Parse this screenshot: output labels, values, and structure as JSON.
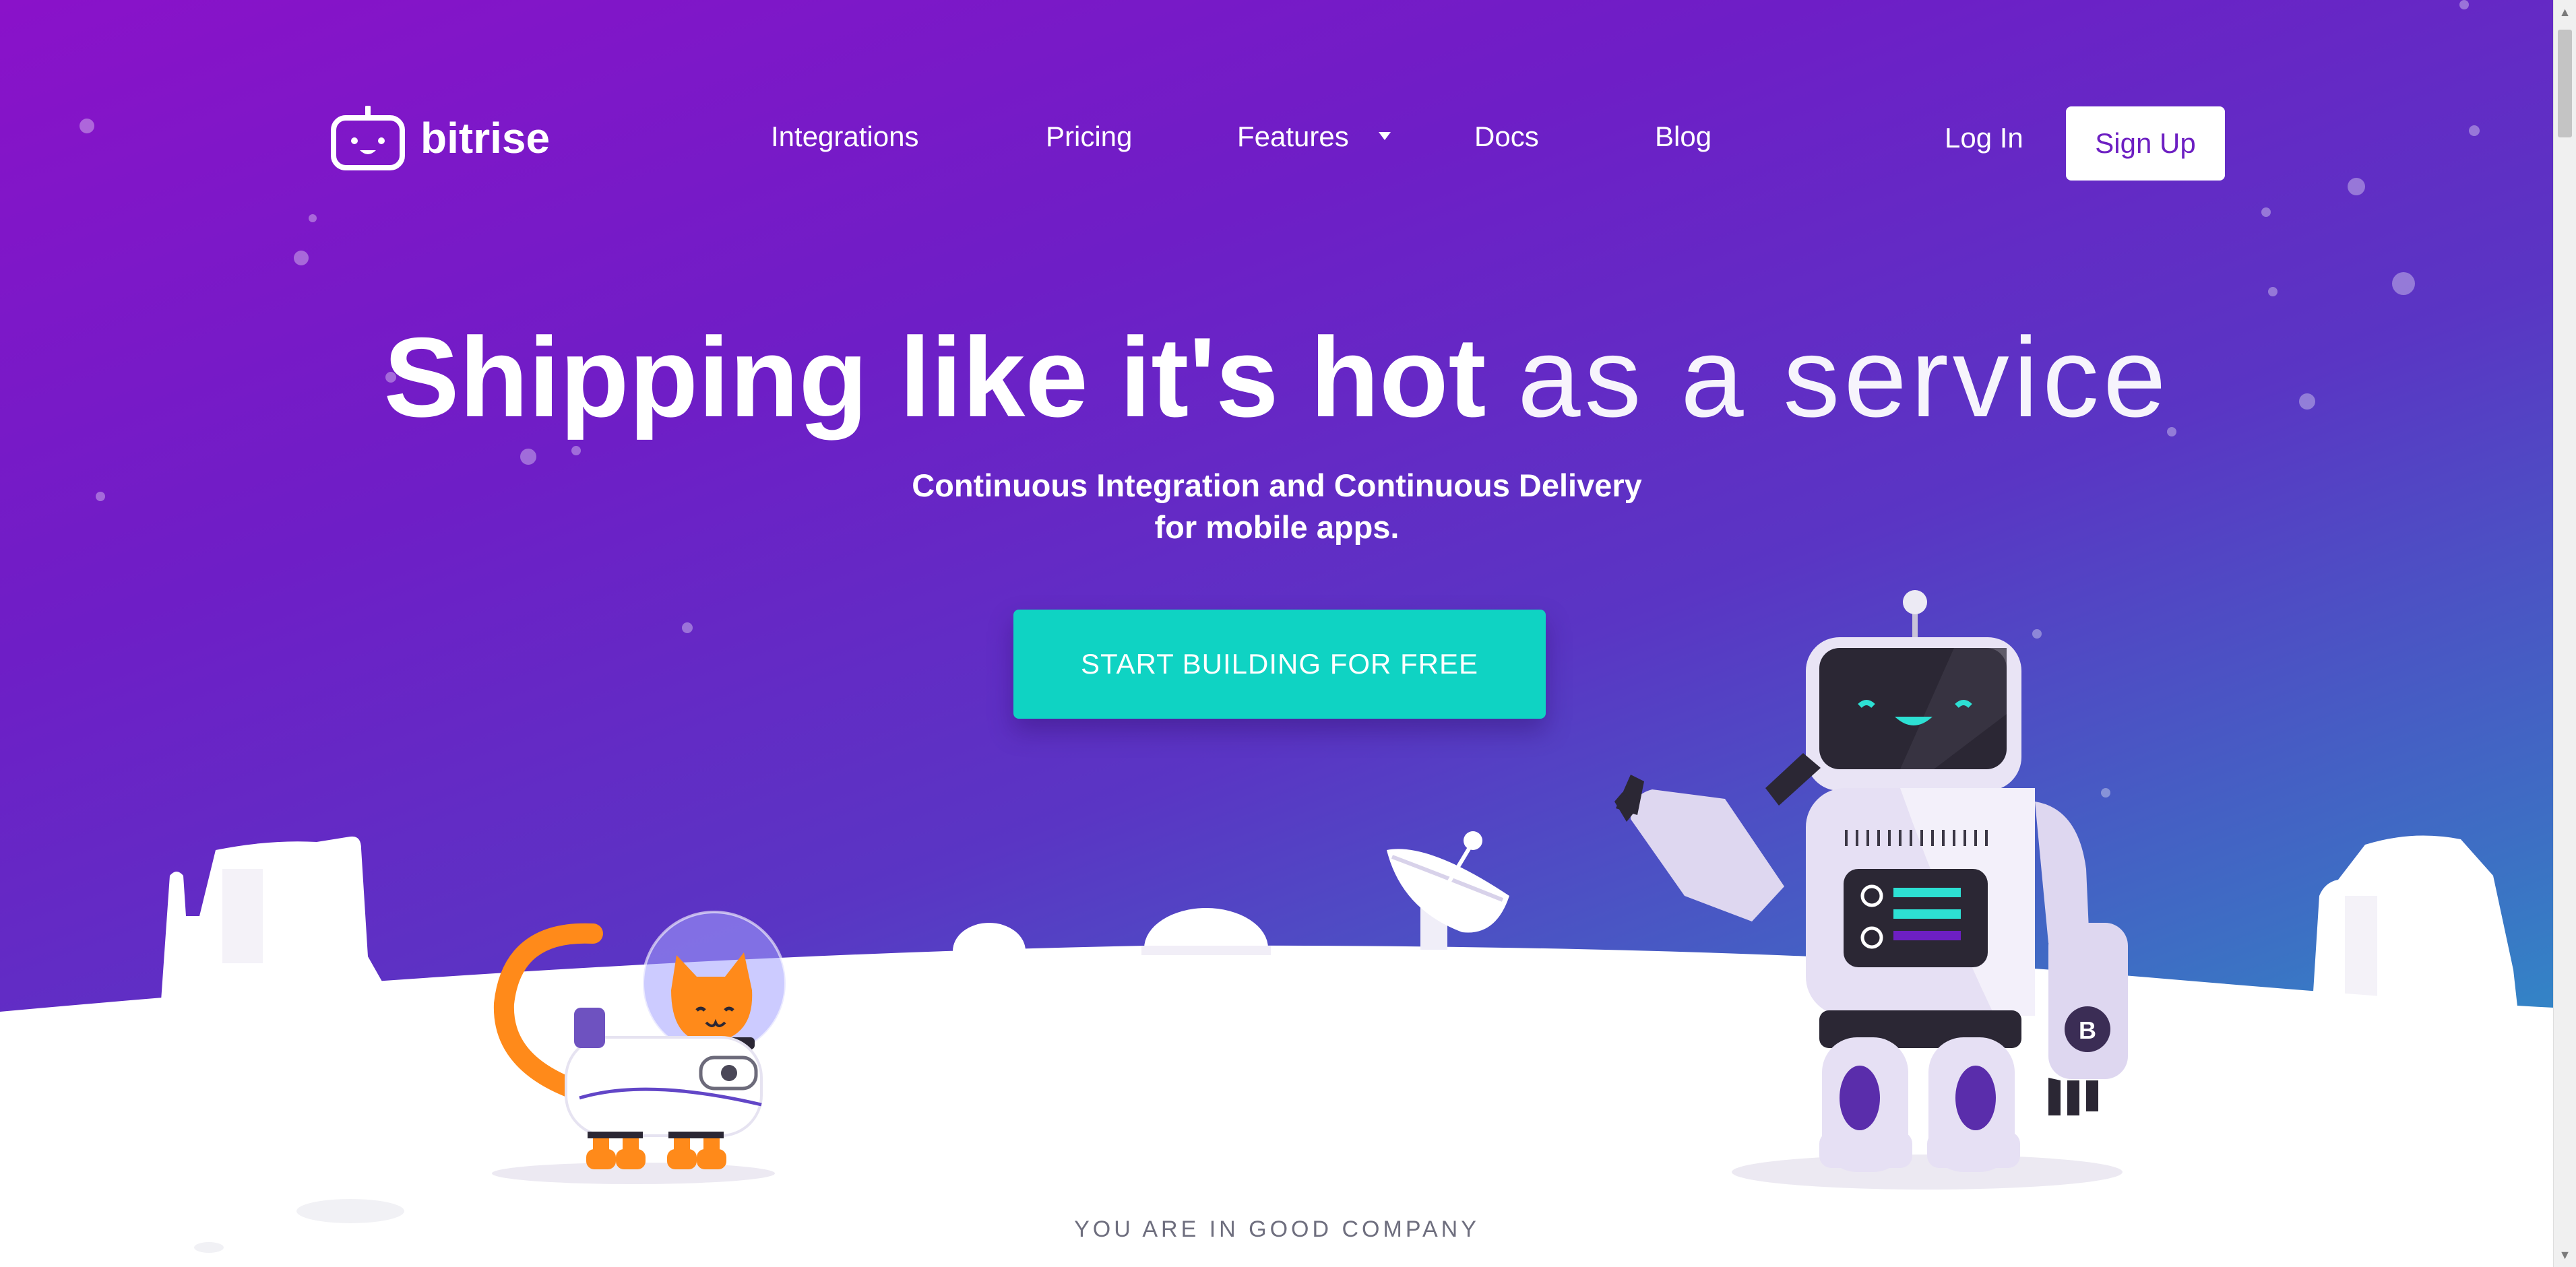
{
  "nav": {
    "logo_text": "bitrise",
    "links": [
      "Integrations",
      "Pricing",
      "Features",
      "Docs",
      "Blog"
    ],
    "login": "Log In",
    "signup": "Sign Up"
  },
  "hero": {
    "headline_bold": "Shipping like it's hot",
    "headline_light": "as a service",
    "sub_line1": "Continuous Integration and Continuous Delivery",
    "sub_line2": "for mobile apps.",
    "cta": "START BUILDING FOR FREE"
  },
  "robot_badge": "B",
  "footer_heading": "YOU ARE IN GOOD COMPANY",
  "icons": [
    "logo-icon",
    "caret-down-icon",
    "robot-illustration",
    "cat-astronaut-illustration",
    "satellite-dish-illustration"
  ],
  "colors": {
    "gradient_start": "#8a12c9",
    "gradient_end": "#25a2c9",
    "cta": "#0fd3c3",
    "signup_text": "#6d1fc2"
  }
}
